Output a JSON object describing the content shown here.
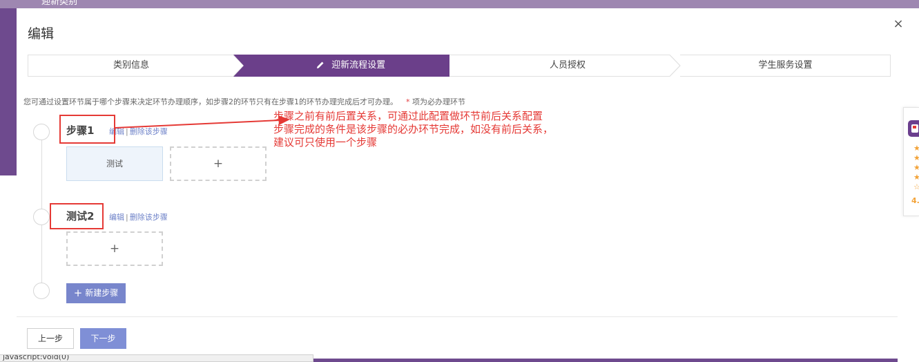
{
  "background": {
    "header_text": "迎新类别"
  },
  "modal": {
    "title": "编辑",
    "close_symbol": "×"
  },
  "stepper": {
    "active_index": 1,
    "steps": [
      {
        "label": "类别信息",
        "state": "done"
      },
      {
        "label": "迎新流程设置",
        "state": "active",
        "icon": "pencil-icon"
      },
      {
        "label": "人员授权",
        "state": "pending"
      },
      {
        "label": "学生服务设置",
        "state": "pending"
      }
    ]
  },
  "hint": {
    "text": "您可通过设置环节属于哪个步骤来决定环节办理顺序，如步骤2的环节只有在步骤1的环节办理完成后才可办理。",
    "required_mark": "*",
    "required_text": "项为必办理环节"
  },
  "flow_steps": [
    {
      "title": "步骤1",
      "edit_label": "编辑",
      "separator": "|",
      "delete_label": "删除该步骤",
      "items": [
        "测试"
      ],
      "add_symbol": "+"
    },
    {
      "title": "测试2",
      "edit_label": "编辑",
      "separator": "|",
      "delete_label": "删除该步骤",
      "items": [],
      "add_symbol": "+"
    }
  ],
  "new_step_button": {
    "icon": "+",
    "label": "新建步骤"
  },
  "footer": {
    "prev_label": "上一步",
    "next_label": "下一步"
  },
  "annotation": {
    "lines": [
      "步骤之前有前后置关系，可通过此配置做环节前后关系配置",
      "步骤完成的条件是该步骤的必办环节完成，如没有前后关系，",
      "建议可只使用一个步骤"
    ],
    "color": "#e53935"
  },
  "statusbar": {
    "text": "javascript:void(0)"
  },
  "side_widget": {
    "stars": [
      "★",
      "★",
      "★",
      "★",
      "☆"
    ],
    "rating": "4."
  },
  "colors": {
    "stepper_active": "#6b3f8a",
    "accent_button": "#7f8fd6",
    "link": "#6f83c9",
    "annotation_red": "#e53935"
  }
}
